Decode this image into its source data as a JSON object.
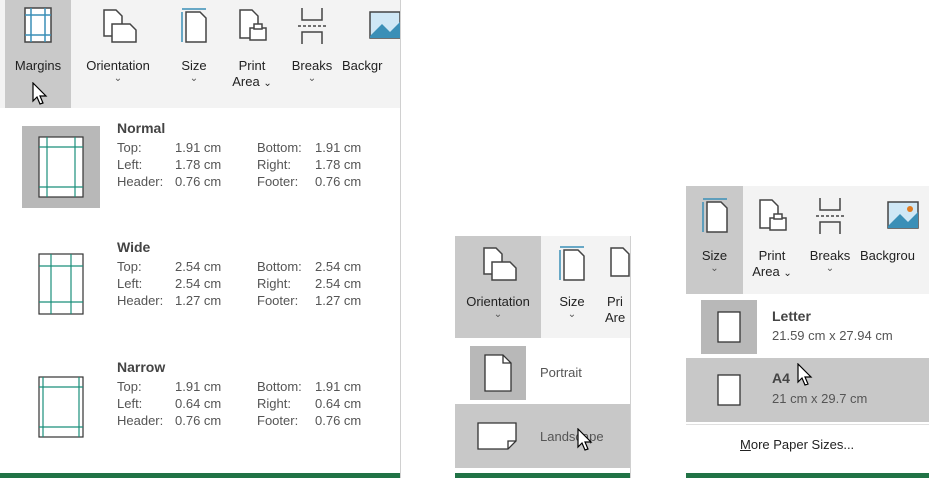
{
  "margins_panel": {
    "ribbon": {
      "margins": "Margins",
      "orientation": "Orientation",
      "size": "Size",
      "print_area_1": "Print",
      "print_area_2": "Area",
      "breaks": "Breaks",
      "background": "Backgr"
    },
    "options": [
      {
        "name": "Normal",
        "top_l": "Top:",
        "top_v": "1.91 cm",
        "bottom_l": "Bottom:",
        "bottom_v": "1.91 cm",
        "left_l": "Left:",
        "left_v": "1.78 cm",
        "right_l": "Right:",
        "right_v": "1.78 cm",
        "header_l": "Header:",
        "header_v": "0.76 cm",
        "footer_l": "Footer:",
        "footer_v": "0.76 cm"
      },
      {
        "name": "Wide",
        "top_l": "Top:",
        "top_v": "2.54 cm",
        "bottom_l": "Bottom:",
        "bottom_v": "2.54 cm",
        "left_l": "Left:",
        "left_v": "2.54 cm",
        "right_l": "Right:",
        "right_v": "2.54 cm",
        "header_l": "Header:",
        "header_v": "1.27 cm",
        "footer_l": "Footer:",
        "footer_v": "1.27 cm"
      },
      {
        "name": "Narrow",
        "top_l": "Top:",
        "top_v": "1.91 cm",
        "bottom_l": "Bottom:",
        "bottom_v": "1.91 cm",
        "left_l": "Left:",
        "left_v": "0.64 cm",
        "right_l": "Right:",
        "right_v": "0.64 cm",
        "header_l": "Header:",
        "header_v": "0.76 cm",
        "footer_l": "Footer:",
        "footer_v": "0.76 cm"
      }
    ]
  },
  "orientation_panel": {
    "ribbon": {
      "orientation": "Orientation",
      "size": "Size",
      "print_1": "Pri",
      "print_2": "Are"
    },
    "options": {
      "portrait": "Portrait",
      "landscape": "Landscape"
    }
  },
  "size_panel": {
    "ribbon": {
      "size": "Size",
      "print_1": "Print",
      "print_2": "Area",
      "breaks": "Breaks",
      "background": "Backgrou"
    },
    "options": [
      {
        "name": "Letter",
        "dims": "21.59 cm x 27.94 cm"
      },
      {
        "name": "A4",
        "dims": "21 cm x 29.7 cm"
      }
    ],
    "more_prefix": "M",
    "more_rest": "ore Paper Sizes..."
  },
  "colors": {
    "accent": "#217346",
    "ribbon": "#f3f3f3",
    "selected": "#c8c8c8"
  }
}
